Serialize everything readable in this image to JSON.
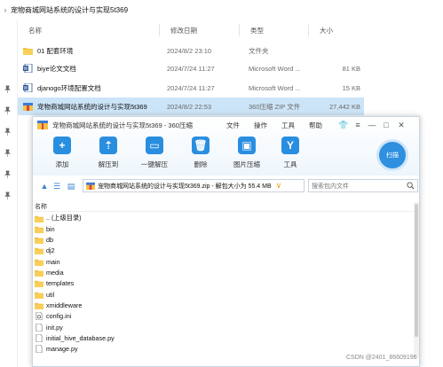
{
  "explorer": {
    "title": "宠物商城网站系统的设计与实现5t369",
    "columns": {
      "name": "名称",
      "modified": "修改日期",
      "type": "类型",
      "size": "大小"
    },
    "rows": [
      {
        "name": "01 配套环境",
        "modified": "2024/8/2 23:10",
        "type": "文件夹",
        "size": "",
        "icon": "folder-icon"
      },
      {
        "name": "biye论文文档",
        "modified": "2024/7/24 11:27",
        "type": "Microsoft Word ...",
        "size": "81 KB",
        "icon": "word-doc-icon"
      },
      {
        "name": "djanogo环境配置文档",
        "modified": "2024/7/24 11:27",
        "type": "Microsoft Word ...",
        "size": "15 KB",
        "icon": "word-doc-icon"
      },
      {
        "name": "宠物商城网站系统的设计与实现5t369",
        "modified": "2024/8/2 22:53",
        "type": "360压缩 ZIP 文件",
        "size": "27,442 KB",
        "icon": "zip-archive-icon"
      }
    ]
  },
  "zip": {
    "title": "宠物商城网站系统的设计与实现5t369 - 360压缩",
    "menu": [
      "文件",
      "操作",
      "工具",
      "帮助"
    ],
    "toolbar": [
      {
        "label": "添加",
        "icon": "add-icon",
        "color": "#2a8ee0"
      },
      {
        "label": "解压到",
        "icon": "extract-to-icon",
        "color": "#2a8ee0"
      },
      {
        "label": "一键解压",
        "icon": "one-click-extract-icon",
        "color": "#2a8ee0"
      },
      {
        "label": "删除",
        "icon": "delete-icon",
        "color": "#2a8ee0"
      },
      {
        "label": "图片压缩",
        "icon": "image-compress-icon",
        "color": "#2a8ee0"
      },
      {
        "label": "工具",
        "icon": "tools-icon",
        "color": "#2a8ee0"
      }
    ],
    "scan_label": "扫描",
    "path": "宠物商城网站系统的设计与实现5t369.zip - 解包大小为 55.4 MB",
    "search_placeholder": "搜索包内文件",
    "list_header": "名称",
    "items": [
      {
        "name": ".. (上级目录)",
        "icon": "folder-icon"
      },
      {
        "name": "bin",
        "icon": "folder-icon"
      },
      {
        "name": "db",
        "icon": "folder-icon"
      },
      {
        "name": "dj2",
        "icon": "folder-icon"
      },
      {
        "name": "main",
        "icon": "folder-icon"
      },
      {
        "name": "media",
        "icon": "folder-icon"
      },
      {
        "name": "templates",
        "icon": "folder-icon"
      },
      {
        "name": "util",
        "icon": "folder-icon"
      },
      {
        "name": "xmiddleware",
        "icon": "folder-icon"
      },
      {
        "name": "config.ini",
        "icon": "settings-file-icon"
      },
      {
        "name": "init.py",
        "icon": "file-icon"
      },
      {
        "name": "initial_hive_database.py",
        "icon": "file-icon"
      },
      {
        "name": "manage.py",
        "icon": "file-icon"
      }
    ]
  },
  "watermark": "CSDN @2401_86609196",
  "colors": {
    "folder": "#f5c242",
    "accent": "#2a8ee0",
    "selection": "#cce4f7"
  }
}
